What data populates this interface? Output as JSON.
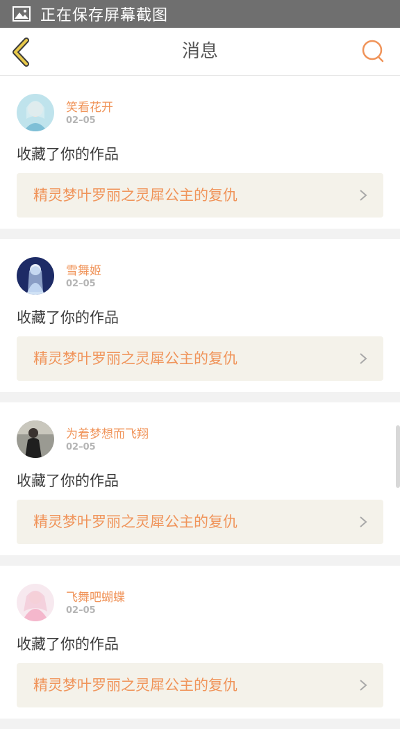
{
  "status_bar": {
    "text": "正在保存屏幕截图",
    "icon": "image-icon"
  },
  "header": {
    "title": "消息",
    "back_icon": "chevron-left-icon",
    "search_icon": "search-icon"
  },
  "colors": {
    "accent": "#f0945a",
    "nav_back": "#e8c94a",
    "work_bg": "#f4f2ea"
  },
  "messages": [
    {
      "user": "笑看花开",
      "date": "02–05",
      "action": "收藏了你的作品",
      "work": "精灵梦叶罗丽之灵犀公主的复仇"
    },
    {
      "user": "雪舞姬",
      "date": "02–05",
      "action": "收藏了你的作品",
      "work": "精灵梦叶罗丽之灵犀公主的复仇"
    },
    {
      "user": "为着梦想而飞翔",
      "date": "02–05",
      "action": "收藏了你的作品",
      "work": "精灵梦叶罗丽之灵犀公主的复仇"
    },
    {
      "user": "飞舞吧蝴蝶",
      "date": "02–05",
      "action": "收藏了你的作品",
      "work": "精灵梦叶罗丽之灵犀公主的复仇"
    }
  ]
}
